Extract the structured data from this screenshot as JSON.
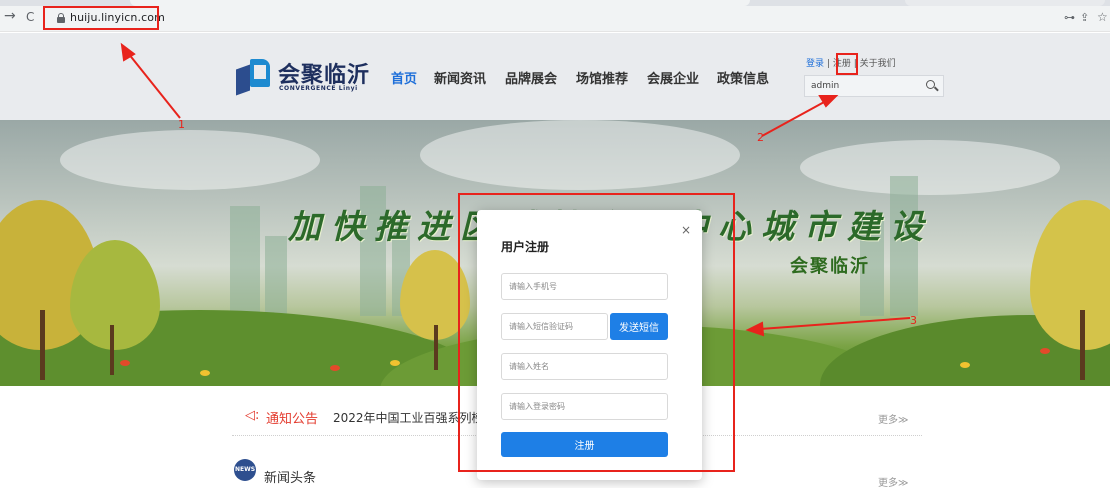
{
  "browser": {
    "back_glyph": "→",
    "reload_glyph": "C",
    "url": "huiju.linyicn.com",
    "key_glyph": "⊶",
    "share_glyph": "⇪",
    "star_glyph": "☆"
  },
  "header": {
    "logo_text": "会聚临沂",
    "logo_subtext": "CONVERGENCE Linyi",
    "nav": [
      "首页",
      "新闻资讯",
      "品牌展会",
      "场馆推荐",
      "会展企业",
      "政策信息"
    ],
    "active_nav": "首页",
    "top_links": {
      "login": "登录",
      "separator": "|",
      "register": "注册",
      "about": "关于我们"
    },
    "search_value": "admin"
  },
  "banner": {
    "title": "加快推进区域性会展中心城市建设",
    "subtitle": "会聚临沂"
  },
  "notice": {
    "icon_glyph": "◁:",
    "label": "通知公告",
    "text": "2022年中国工业百强系列榜单",
    "more": "更多≫"
  },
  "news": {
    "icon_text": "NEWS",
    "label": "新闻头条",
    "more": "更多≫"
  },
  "modal": {
    "title": "用户注册",
    "close_glyph": "×",
    "phone_placeholder": "请输入手机号",
    "sms_placeholder": "请输入短信验证码",
    "send_sms_label": "发送短信",
    "name_placeholder": "请输入姓名",
    "password_placeholder": "请输入登录密码",
    "submit_label": "注册"
  },
  "annotations": {
    "one": "1",
    "two": "2",
    "three": "3"
  },
  "colors": {
    "accent_blue": "#1e7fe6",
    "annotation_red": "#e8231c",
    "notice_red": "#e33b2e",
    "nav_active": "#1e6fd9"
  }
}
